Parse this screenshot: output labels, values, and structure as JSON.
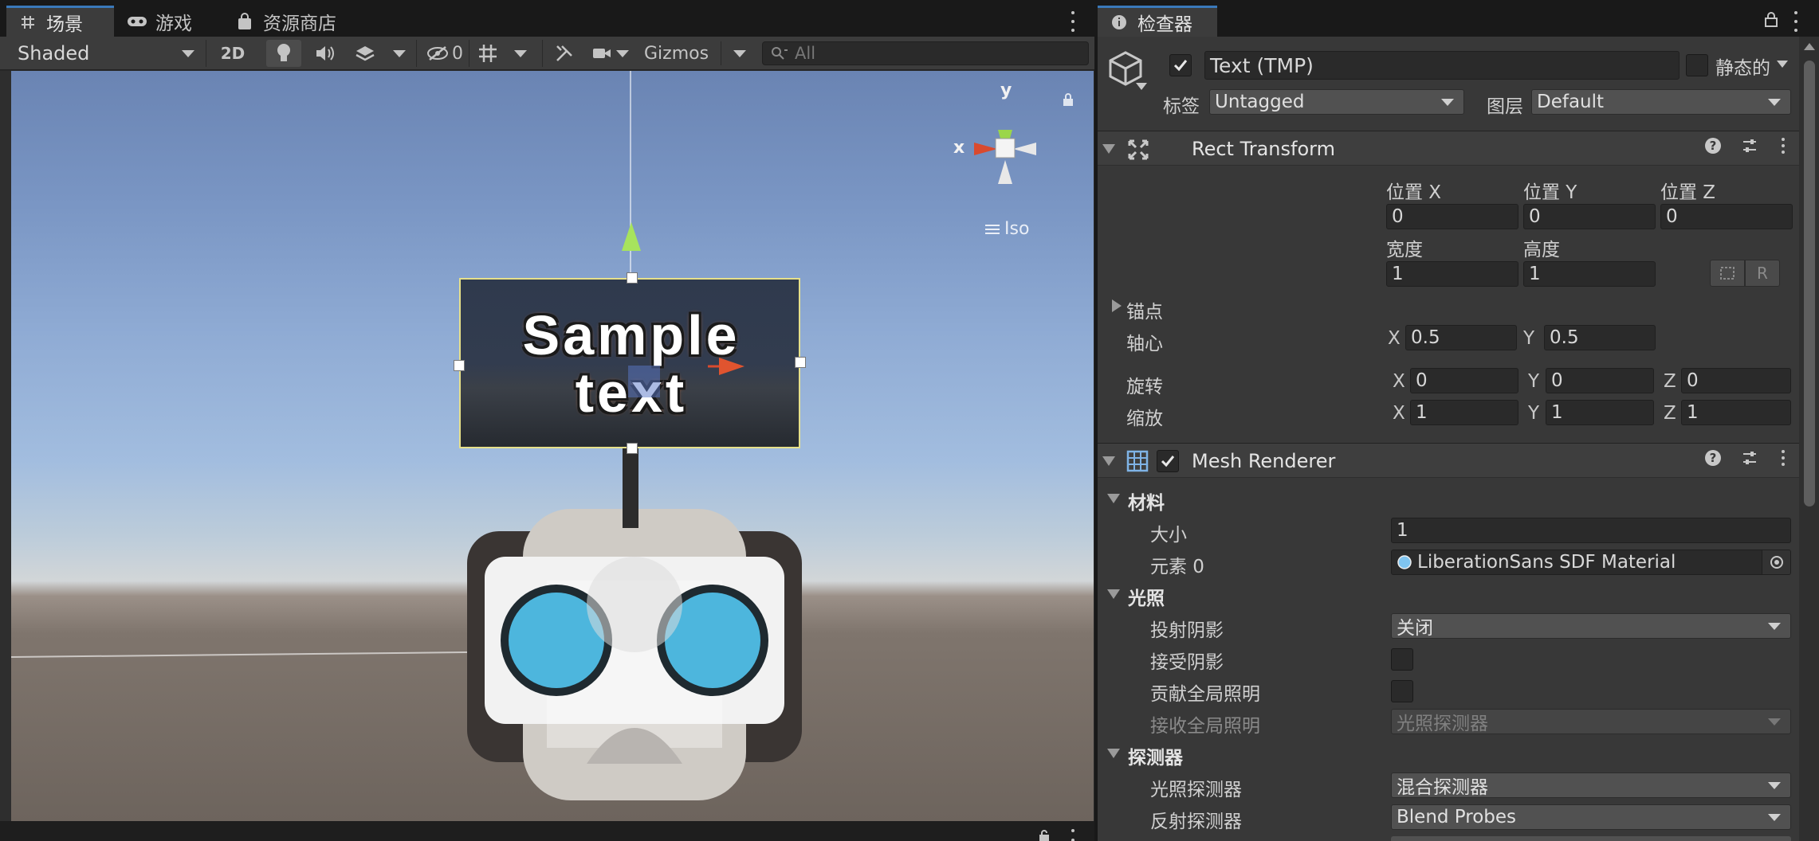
{
  "scene": {
    "tabs": [
      {
        "label": "场景",
        "icon": "grid-icon"
      },
      {
        "label": "游戏",
        "icon": "gamepad-icon"
      },
      {
        "label": "资源商店",
        "icon": "shopping-bag-icon"
      }
    ],
    "toolbar": {
      "shading_mode": "Shaded",
      "mode_2d": "2D",
      "hidden_count": "0",
      "gizmos_label": "Gizmos",
      "search_placeholder": "All"
    },
    "viewport": {
      "sample_text_line1": "Sample",
      "sample_text_line2": "text",
      "gizmo_y": "y",
      "gizmo_x": "x",
      "projection_label": "Iso"
    }
  },
  "inspector": {
    "tab_label": "检查器",
    "object": {
      "active": true,
      "name": "Text (TMP)",
      "static_label": "静态的",
      "tag_label": "标签",
      "tag_value": "Untagged",
      "layer_label": "图层",
      "layer_value": "Default"
    },
    "rect_transform": {
      "title": "Rect Transform",
      "pos_x_label": "位置 X",
      "pos_y_label": "位置 Y",
      "pos_z_label": "位置 Z",
      "pos_x": "0",
      "pos_y": "0",
      "pos_z": "0",
      "width_label": "宽度",
      "height_label": "高度",
      "width": "1",
      "height": "1",
      "raw_button": "R",
      "anchors_label": "锚点",
      "pivot_label": "轴心",
      "pivot_x": "0.5",
      "pivot_y": "0.5",
      "rotation_label": "旋转",
      "rot_x": "0",
      "rot_y": "0",
      "rot_z": "0",
      "scale_label": "缩放",
      "scale_x": "1",
      "scale_y": "1",
      "scale_z": "1",
      "axis_x": "X",
      "axis_y": "Y",
      "axis_z": "Z"
    },
    "mesh_renderer": {
      "title": "Mesh Renderer",
      "enabled": true,
      "materials_label": "材料",
      "size_label": "大小",
      "size_value": "1",
      "element0_label": "元素 0",
      "element0_value": "LiberationSans SDF Material",
      "lighting_label": "光照",
      "cast_shadows_label": "投射阴影",
      "cast_shadows_value": "关闭",
      "receive_shadows_label": "接受阴影",
      "receive_shadows": false,
      "contribute_gi_label": "贡献全局照明",
      "contribute_gi": false,
      "receive_gi_label": "接收全局照明",
      "receive_gi_value": "光照探测器",
      "probes_label": "探测器",
      "light_probes_label": "光照探测器",
      "light_probes_value": "混合探测器",
      "reflection_probes_label": "反射探测器",
      "reflection_probes_value": "Blend Probes"
    }
  },
  "colors": {
    "tab_accent": "#3a79bb",
    "panel_bg": "#383838",
    "field_bg": "#2a2a2a",
    "selection_outline": "#e6e08a",
    "gizmo_x": "#d94a2e",
    "gizmo_y": "#9bd64a"
  }
}
